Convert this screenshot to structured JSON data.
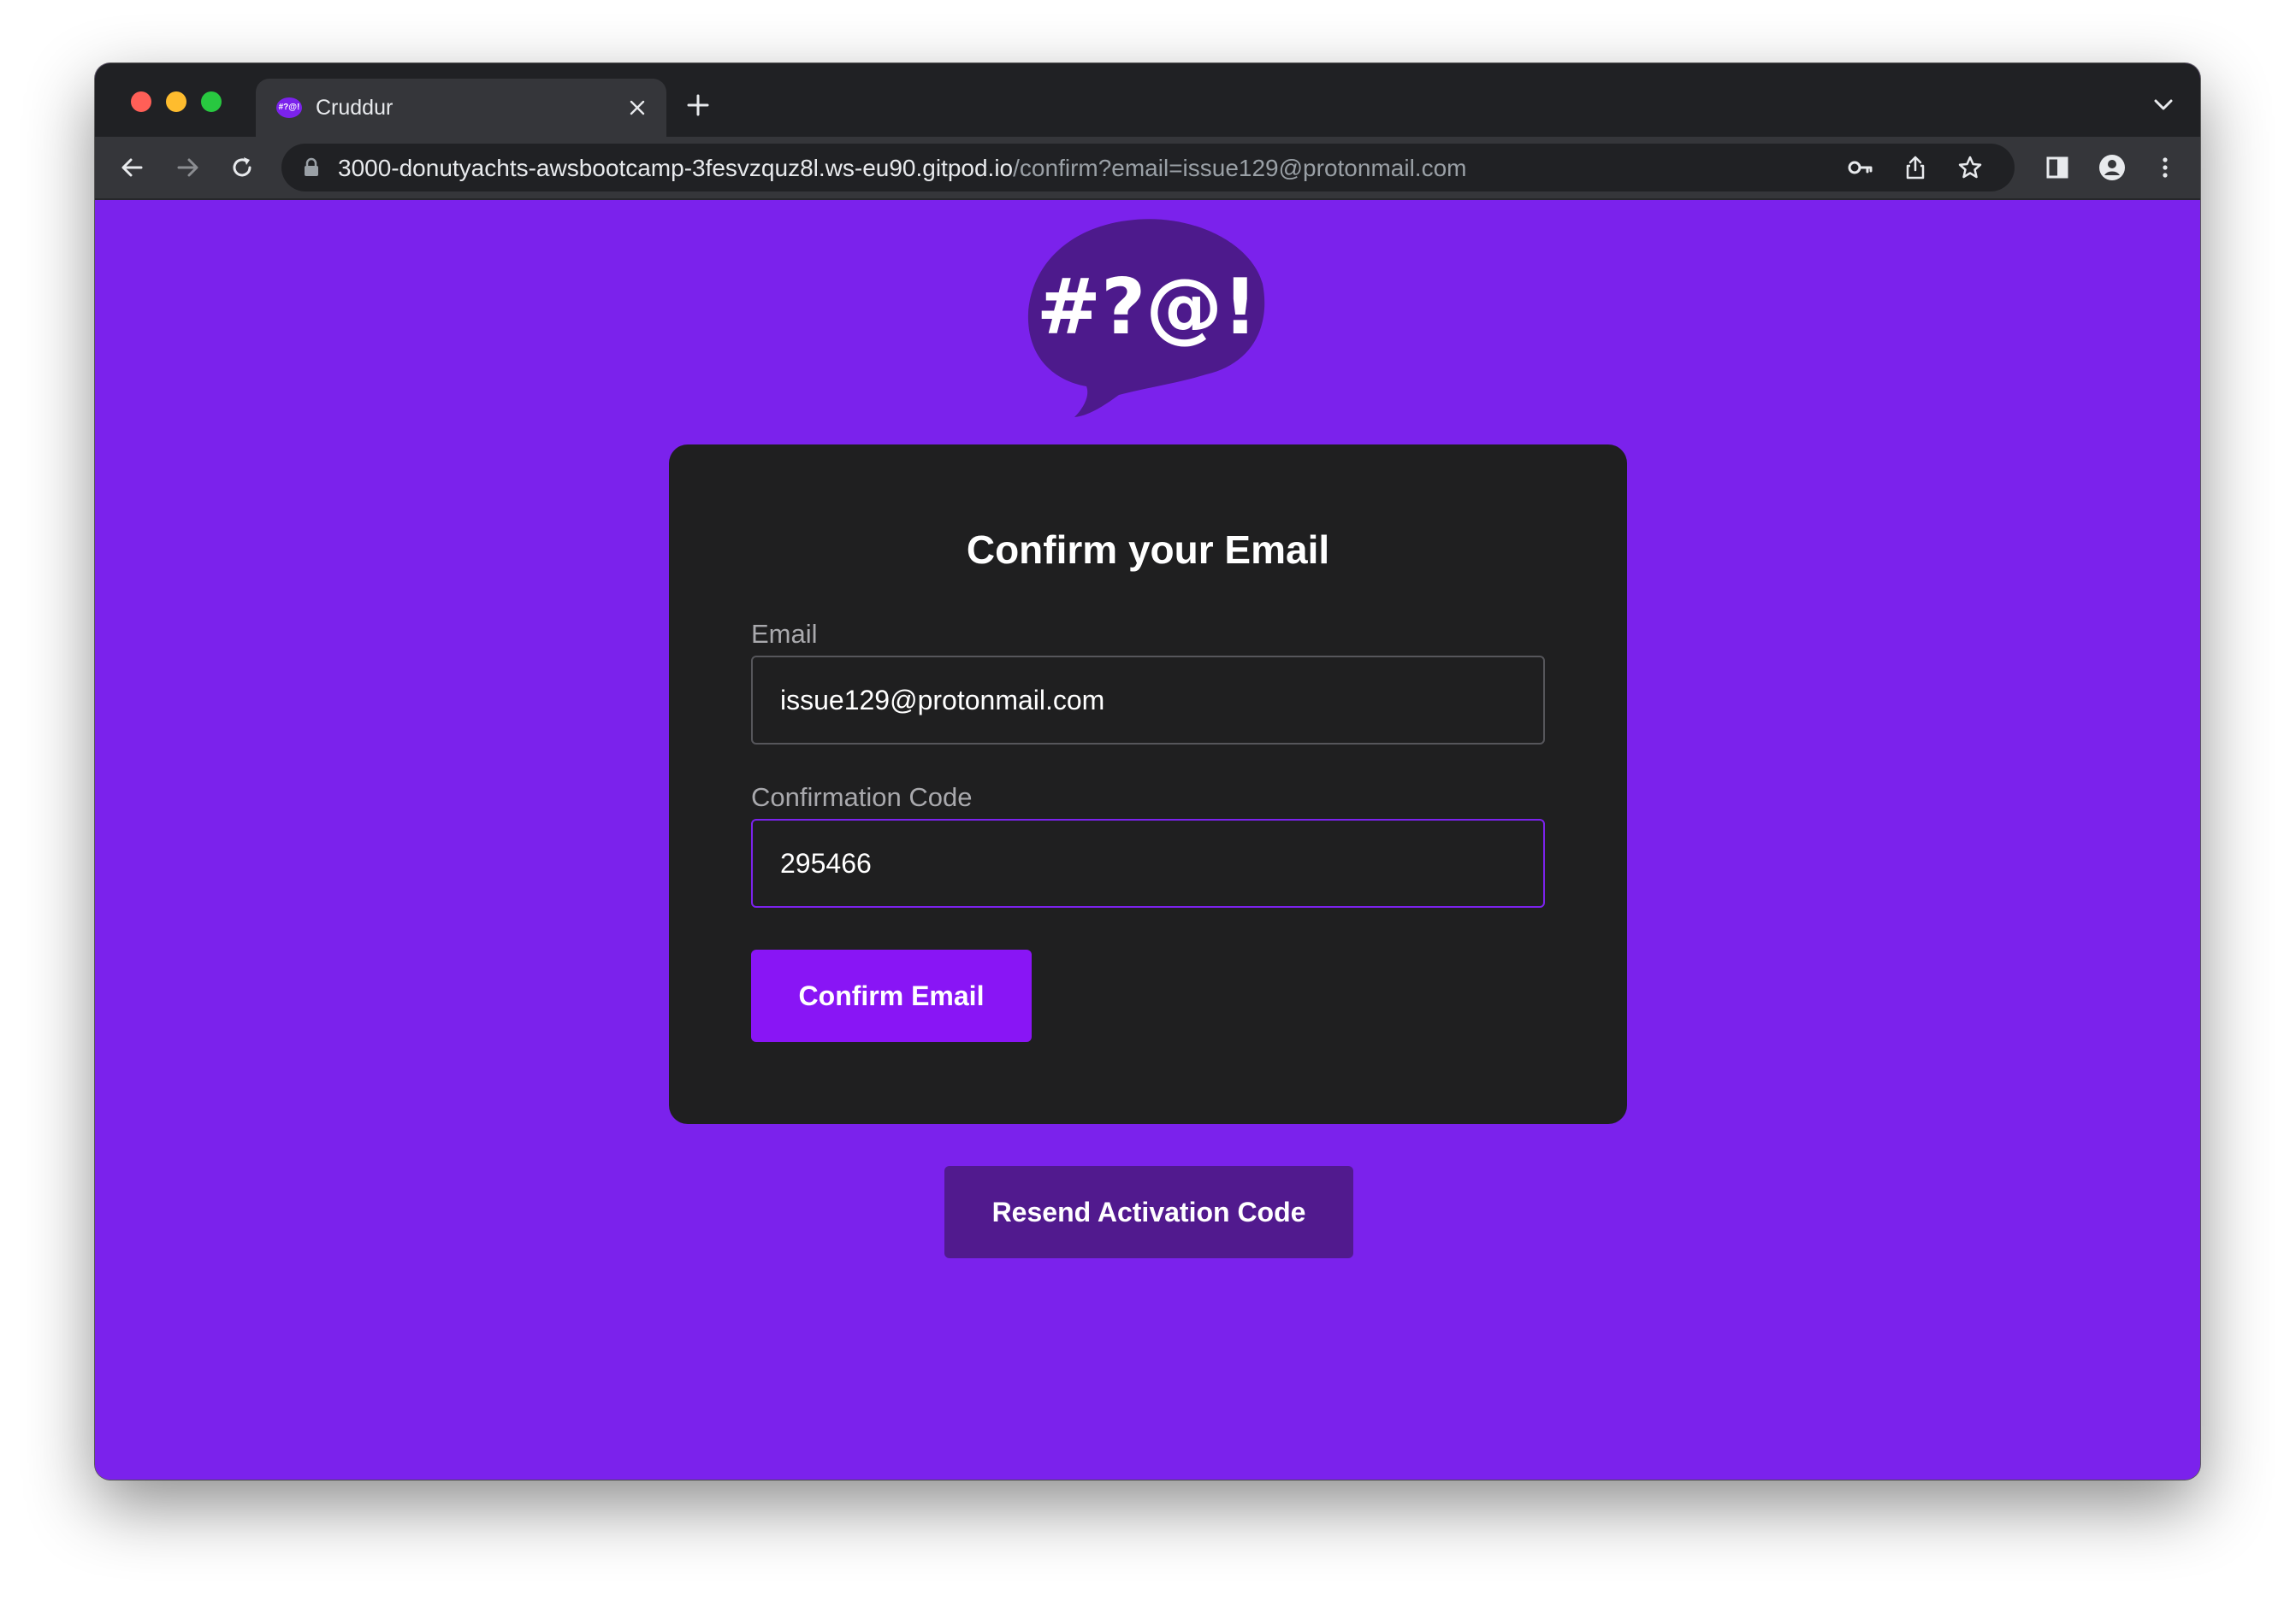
{
  "browser": {
    "tab_title": "Cruddur",
    "url_host": "3000-donutyachts-awsbootcamp-3fesvzquz8l.ws-eu90.gitpod.io",
    "url_path": "/confirm?email=issue129@protonmail.com"
  },
  "logo": {
    "text": "#?@!"
  },
  "form": {
    "title": "Confirm your Email",
    "email_label": "Email",
    "email_value": "issue129@protonmail.com",
    "code_label": "Confirmation Code",
    "code_value": "295466",
    "submit_label": "Confirm Email"
  },
  "resend_label": "Resend Activation Code",
  "colors": {
    "page_background": "#7b22ec",
    "card_background": "#1f1f20",
    "primary_button": "#8915f5",
    "secondary_button": "#511a8e",
    "logo_bubble": "#4d1a8c"
  },
  "icons": {
    "favicon": "cruddur-logo-icon",
    "tab_close": "close-icon",
    "new_tab": "plus-icon",
    "tab_menu": "chevron-down-icon",
    "back": "back-arrow-icon",
    "forward": "forward-arrow-icon",
    "reload": "reload-icon",
    "lock": "lock-icon",
    "passwords": "key-icon",
    "share": "share-icon",
    "bookmark": "star-icon",
    "side_panel": "side-panel-icon",
    "profile": "profile-icon",
    "menu": "kebab-menu-icon"
  }
}
